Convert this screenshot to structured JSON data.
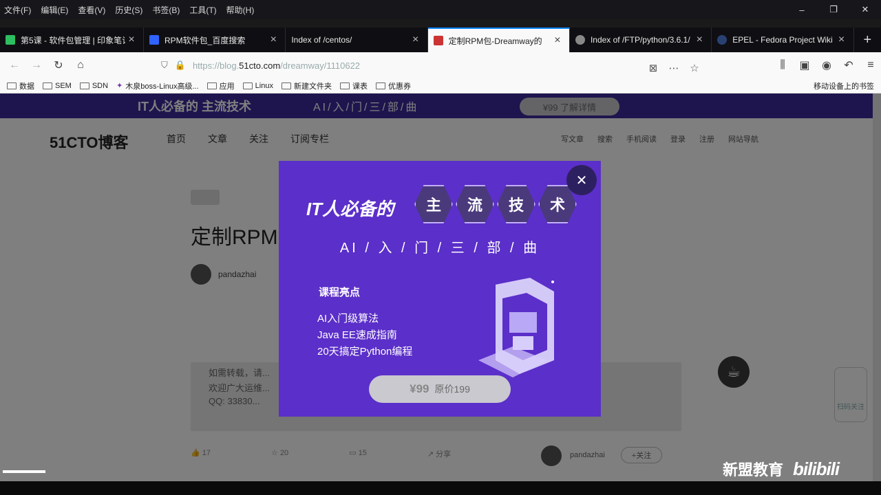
{
  "menu": [
    "文件(F)",
    "编辑(E)",
    "查看(V)",
    "历史(S)",
    "书签(B)",
    "工具(T)",
    "帮助(H)"
  ],
  "window_controls": [
    "–",
    "❐",
    "✕"
  ],
  "tabs": [
    {
      "title": "第5课 - 软件包管理 | 印象笔记",
      "active": false
    },
    {
      "title": "RPM软件包_百度搜索",
      "active": false
    },
    {
      "title": "Index of /centos/",
      "active": false
    },
    {
      "title": "定制RPM包-Dreamway的",
      "active": true
    },
    {
      "title": "Index of /FTP/python/3.6.1/",
      "active": false
    },
    {
      "title": "EPEL - Fedora Project Wiki",
      "active": false
    }
  ],
  "tab_close": "×",
  "tab_new": "+",
  "nav": {
    "back": "←",
    "forward": "→",
    "reload": "↻",
    "home": "⌂"
  },
  "url": {
    "prefix": "https://blog.",
    "host": "51cto.com",
    "path": "/dreamway/1110622"
  },
  "url_icons": [
    "⊠",
    "⋯",
    "☆"
  ],
  "toolbar_icons": [
    "⫼",
    "▣",
    "◉",
    "↶",
    "≡"
  ],
  "bookmarks": [
    "数据",
    "SEM",
    "SDN",
    "木泉boss-Linux高级...",
    "应用",
    "Linux",
    "新建文件夹",
    "课表",
    "优惠券"
  ],
  "bookmark_mobile": "移动设备上的书签",
  "banner": {
    "title": "IT人必备的 主流技术",
    "sub": "AI/入/门/三/部/曲",
    "price": "¥99 了解详情"
  },
  "site": {
    "logo": "51CTO博客",
    "nav": [
      "首页",
      "文章",
      "关注",
      "订阅专栏"
    ],
    "right": [
      "写文章",
      "搜索",
      "手机阅读",
      "登录",
      "注册",
      "网站导航"
    ]
  },
  "article": {
    "title": "定制RPM",
    "author": "pandazhai",
    "quote_lines": [
      "如需转载，请...",
      "欢迎广大运维...",
      "QQ: 33830..."
    ],
    "actions": [
      "17",
      "20",
      "15",
      "分享"
    ],
    "author2": "pandazhai",
    "follow": "+关注"
  },
  "modal": {
    "title": "IT人必备的",
    "hex": [
      "主",
      "流",
      "技",
      "术"
    ],
    "subtitle": "AI / 入 / 门 / 三 / 部 / 曲",
    "highlight": "课程亮点",
    "items": [
      "AI入门级算法",
      "Java EE速成指南",
      "20天搞定Python编程"
    ],
    "price": "¥99",
    "price_note": "原价199",
    "close": "✕"
  },
  "side_widget": "扫码关注",
  "watermark": {
    "text": "新盟教育",
    "bili": "bilibili"
  },
  "colors": {
    "modal_bg": "#5b2fc9",
    "accent": "#0a84ff",
    "price_btn": "#c9c9cf"
  }
}
